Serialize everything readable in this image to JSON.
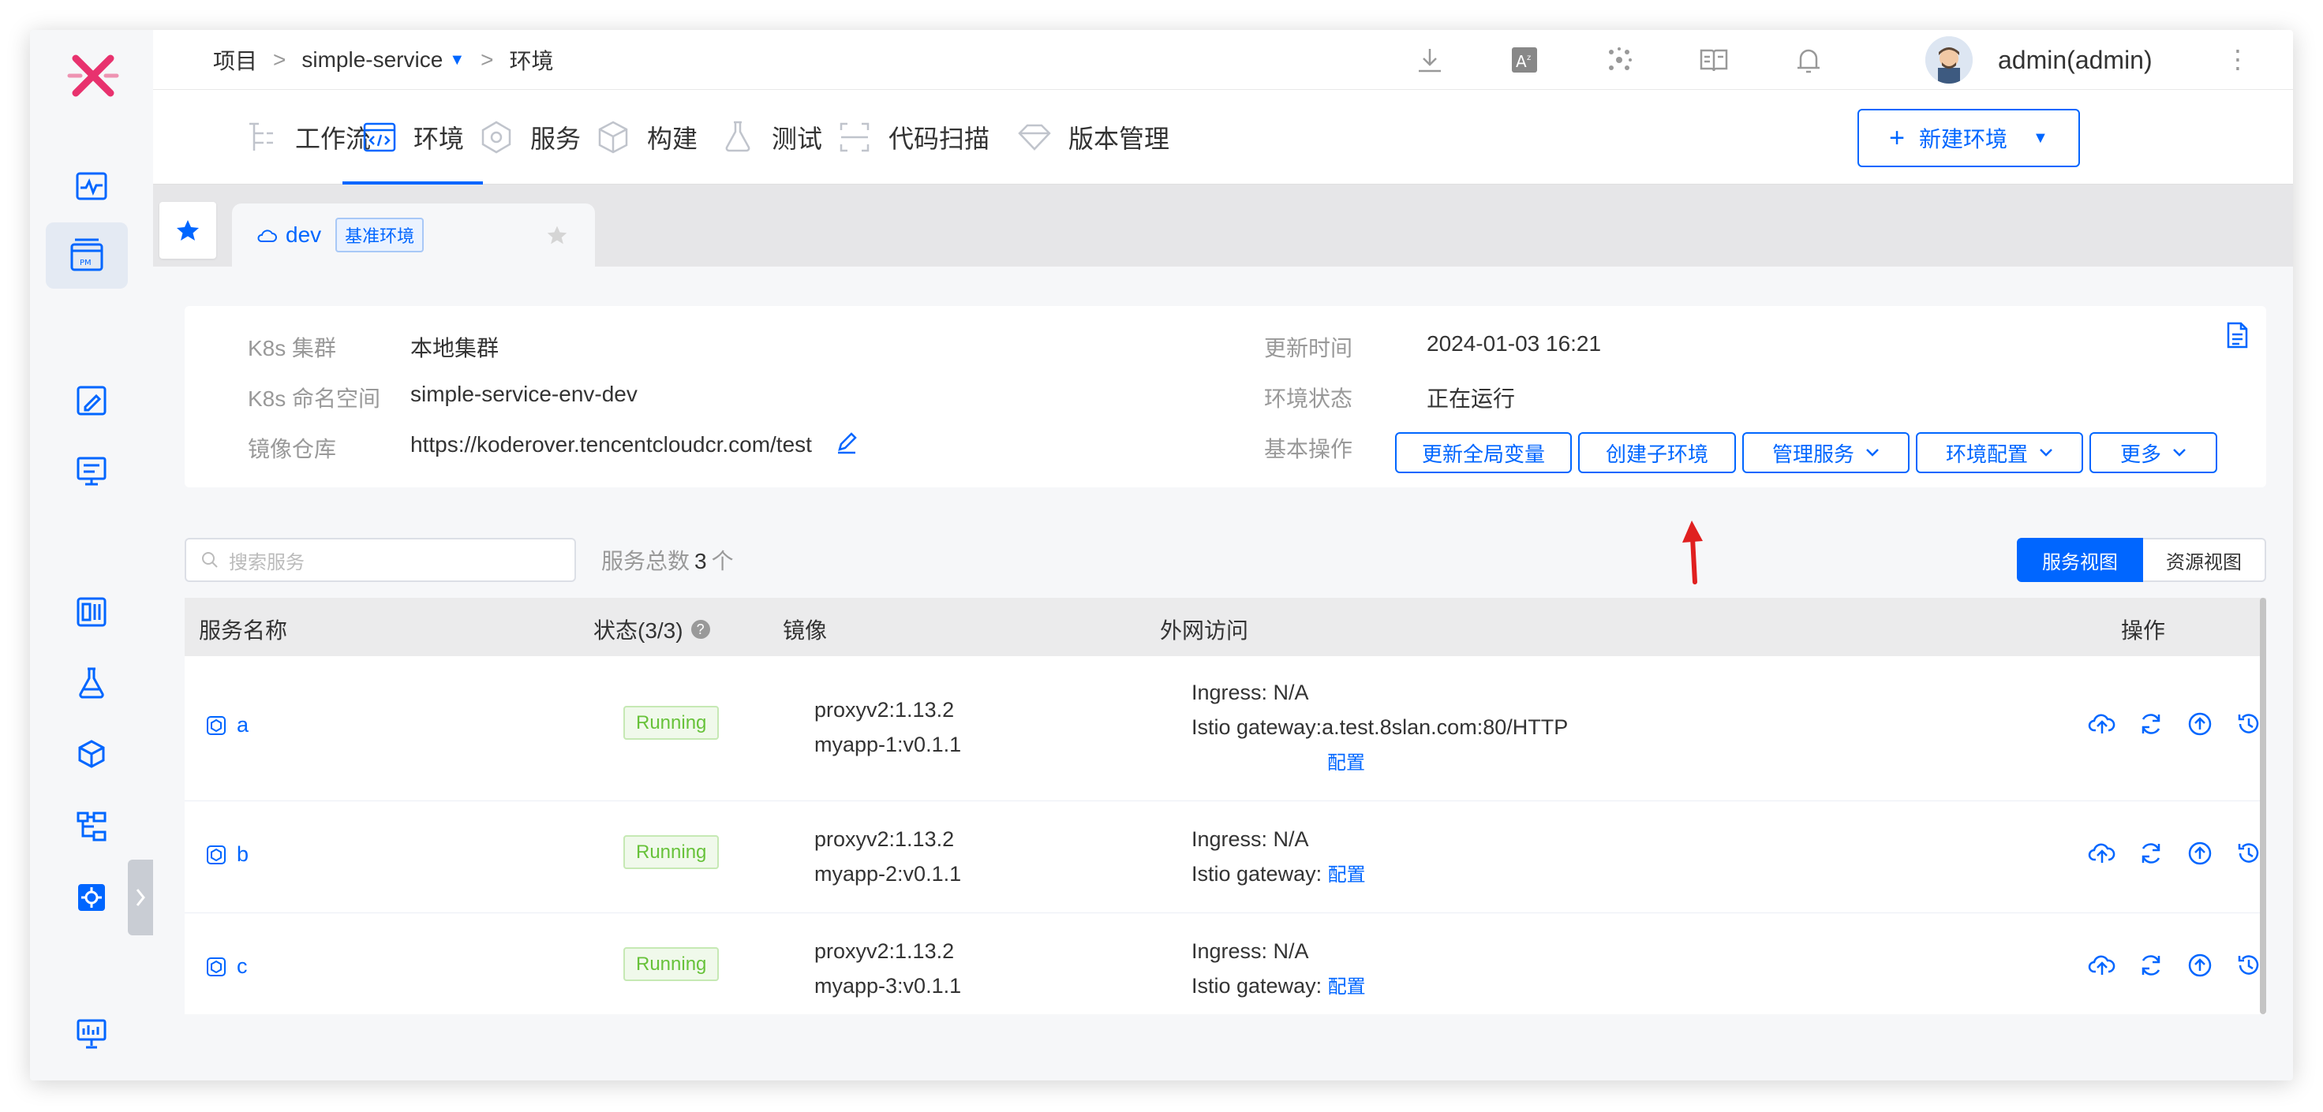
{
  "colors": {
    "accent": "#0066ff",
    "logo": "#e8326e",
    "running": "#67c23a",
    "arrow": "#e02020"
  },
  "topbar": {
    "crumbs": {
      "project": "项目",
      "sep": ">",
      "service": "simple-service",
      "env": "环境"
    },
    "user": "admin(admin)",
    "icons": [
      "download-icon",
      "translate-icon",
      "cluster-icon",
      "docs-book-icon",
      "bell-icon",
      "more-vertical-icon"
    ]
  },
  "nav": {
    "tabs": [
      {
        "label": "工作流",
        "icon": "workflow-icon"
      },
      {
        "label": "环境",
        "icon": "code-env-icon",
        "active": true
      },
      {
        "label": "服务",
        "icon": "service-icon"
      },
      {
        "label": "构建",
        "icon": "build-box-icon"
      },
      {
        "label": "测试",
        "icon": "flask-icon"
      },
      {
        "label": "代码扫描",
        "icon": "scan-icon"
      },
      {
        "label": "版本管理",
        "icon": "diamond-icon"
      }
    ],
    "new_env": "新建环境"
  },
  "env_tab": {
    "name": "dev",
    "badge": "基准环境"
  },
  "info": {
    "k8s_cluster_label": "K8s 集群",
    "k8s_cluster": "本地集群",
    "k8s_ns_label": "K8s 命名空间",
    "k8s_ns": "simple-service-env-dev",
    "registry_label": "镜像仓库",
    "registry": "https://koderover.tencentcloudcr.com/test",
    "updated_label": "更新时间",
    "updated": "2024-01-03 16:21",
    "status_label": "环境状态",
    "status": "正在运行",
    "ops_label": "基本操作",
    "ops": {
      "update_vars": "更新全局变量",
      "create_sub": "创建子环境",
      "manage_services": "管理服务",
      "env_config": "环境配置",
      "more": "更多"
    }
  },
  "list": {
    "search_placeholder": "搜索服务",
    "total_label": "服务总数",
    "total_count": "3",
    "total_unit": "个",
    "view_service": "服务视图",
    "view_resource": "资源视图"
  },
  "table": {
    "headers": {
      "name": "服务名称",
      "status": "状态(3/3)",
      "image": "镜像",
      "external": "外网访问",
      "actions": "操作"
    },
    "rows": [
      {
        "name": "a",
        "status": "Running",
        "image1": "proxyv2:1.13.2",
        "image2": "myapp-1:v0.1.1",
        "ingress": "Ingress: N/A",
        "istio_label": "Istio gateway:",
        "istio_value": "a.test.8slan.com:80/HTTP",
        "config": "配置"
      },
      {
        "name": "b",
        "status": "Running",
        "image1": "proxyv2:1.13.2",
        "image2": "myapp-2:v0.1.1",
        "ingress": "Ingress: N/A",
        "istio_label": "Istio gateway:",
        "istio_value": "",
        "config": "配置"
      },
      {
        "name": "c",
        "status": "Running",
        "image1": "proxyv2:1.13.2",
        "image2": "myapp-3:v0.1.1",
        "ingress": "Ingress: N/A",
        "istio_label": "Istio gateway:",
        "istio_value": "",
        "config": "配置"
      }
    ]
  }
}
